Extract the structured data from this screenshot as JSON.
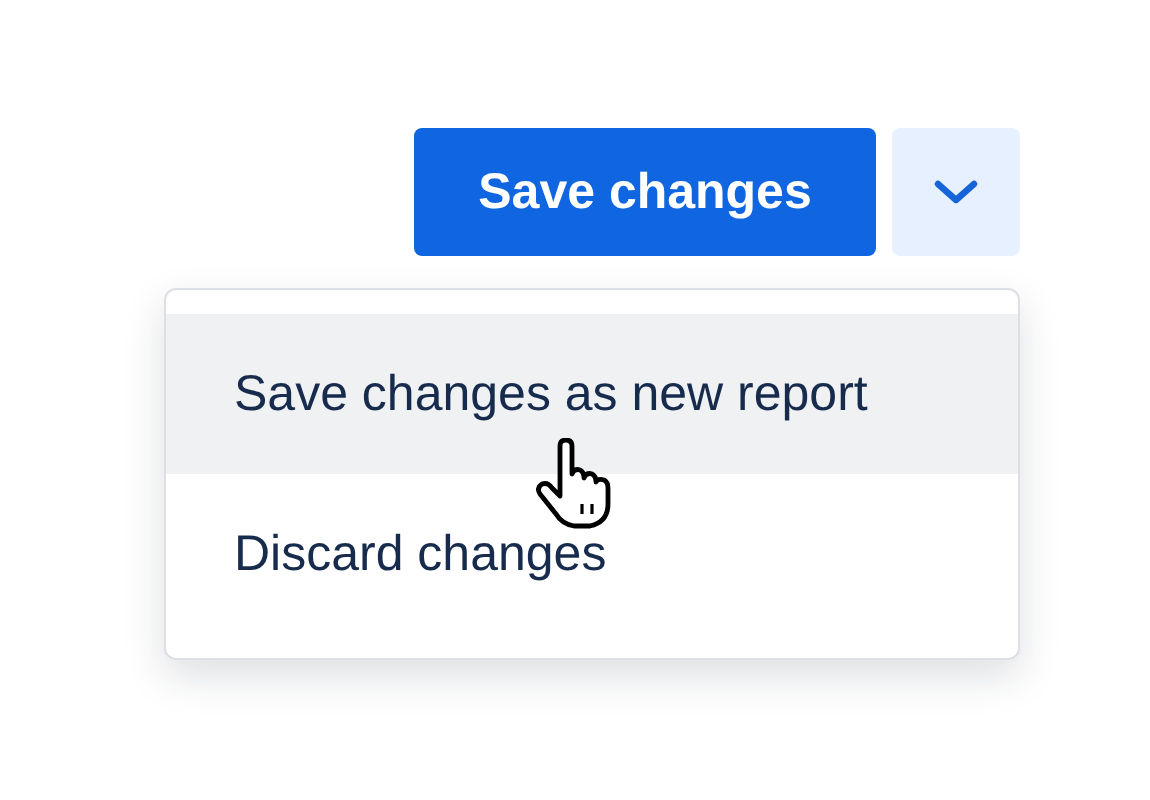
{
  "split_button": {
    "label": "Save changes",
    "expanded": true
  },
  "menu": {
    "items": [
      {
        "label": "Save changes as new report",
        "selected": true
      },
      {
        "label": "Discard changes",
        "selected": false
      }
    ]
  }
}
